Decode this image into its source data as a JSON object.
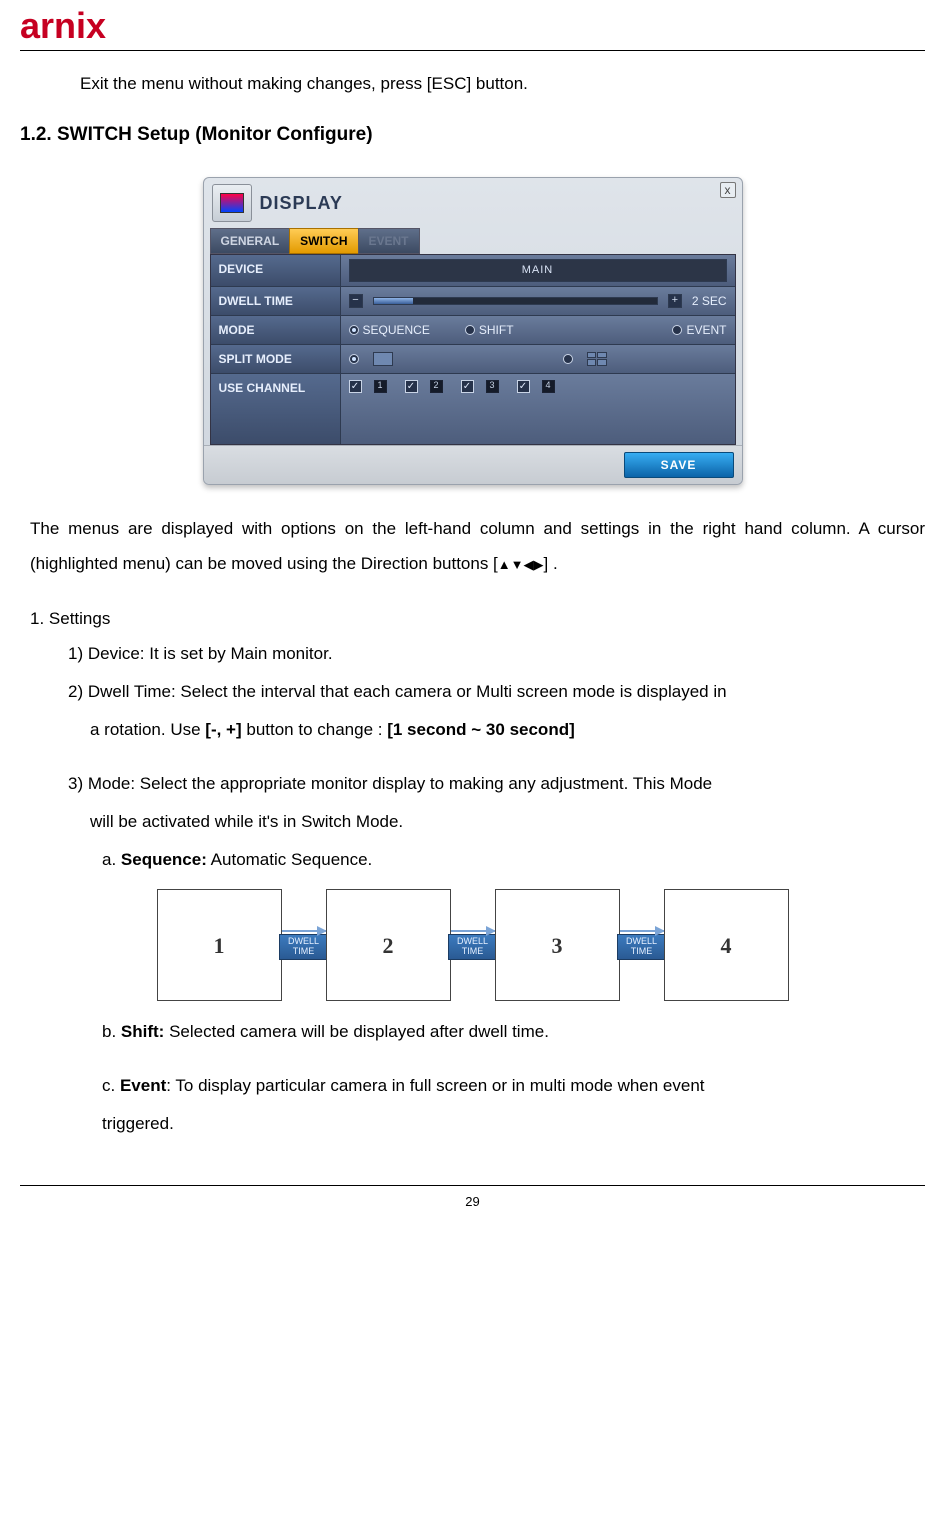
{
  "logo_text": "arnix",
  "intro_line": "Exit the menu without making changes, press [ESC] button.",
  "section_heading": "1.2. SWITCH Setup (Monitor Configure)",
  "panel": {
    "title": "DISPLAY",
    "close": "x",
    "tabs": {
      "general": "GENERAL",
      "switch": "SWITCH",
      "event": "EVENT"
    },
    "rows": {
      "device_label": "DEVICE",
      "device_value": "MAIN",
      "dwell_label": "DWELL TIME",
      "dwell_minus": "−",
      "dwell_plus": "+",
      "dwell_value": "2 SEC",
      "mode_label": "MODE",
      "mode_sequence": "SEQUENCE",
      "mode_shift": "SHIFT",
      "mode_event": "EVENT",
      "split_label": "SPLIT MODE",
      "use_label": "USE CHANNEL",
      "ch1": "1",
      "ch2": "2",
      "ch3": "3",
      "ch4": "4",
      "check": "✓"
    },
    "save": "SAVE"
  },
  "paragraph1a": "The menus are displayed with options on the left-hand column and settings in the right hand",
  "paragraph1b": "column.    A cursor (highlighted menu) can be moved using the Direction buttons [",
  "paragraph1c": "] .",
  "dir": {
    "u": "▲",
    "d": "▼",
    "l": "◀",
    "r": "▶"
  },
  "list": {
    "settings": "1.   Settings",
    "device": "1)  Device: It is set by Main monitor.",
    "dwell_a": "2)  Dwell Time: Select the interval that each camera or Multi screen mode is displayed in",
    "dwell_b": "a rotation. Use ",
    "dwell_bold": "[-, +]",
    "dwell_c": " button to change : ",
    "dwell_range": "[1 second ~ 30 second]",
    "mode_a": "3)  Mode: Select the appropriate monitor display to making any adjustment. This Mode",
    "mode_b": "will be activated while it's in Switch Mode.",
    "seq_label": "a. ",
    "seq_bold": "Sequence:",
    "seq_rest": " Automatic Sequence.",
    "shift_label": "b. ",
    "shift_bold": "Shift:",
    "shift_rest": " Selected camera will be displayed after dwell time.",
    "event_label": "c. ",
    "event_bold": "Event",
    "event_rest": ": To display particular camera in full screen or in multi mode when event",
    "event_rest2": "triggered."
  },
  "seq_diagram": {
    "screens": [
      "1",
      "2",
      "3",
      "4"
    ],
    "dwell_line1": "DWELL",
    "dwell_line2": "TIME"
  },
  "page_number": "29"
}
